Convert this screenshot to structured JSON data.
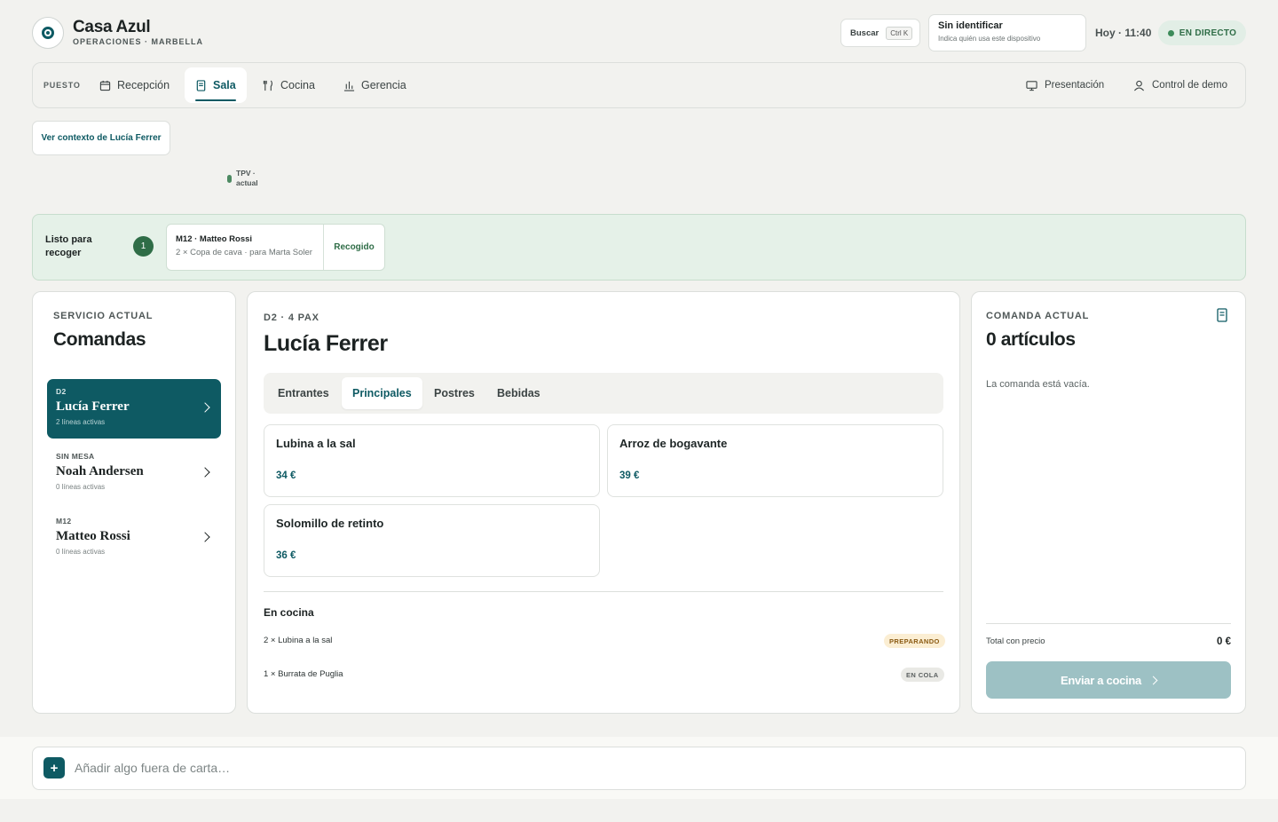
{
  "header": {
    "brand": "Casa Azul",
    "subtitle": "OPERACIONES · MARBELLA",
    "search_label": "Buscar",
    "search_shortcut": "Ctrl K",
    "identity_title": "Sin identificar",
    "identity_hint": "Indica quién usa este dispositivo",
    "time": "Hoy · 11:40",
    "live_label": "EN DIRECTO"
  },
  "nav": {
    "label": "PUESTO",
    "tabs": [
      {
        "label": "Recepción",
        "icon": "calendar-icon"
      },
      {
        "label": "Sala",
        "icon": "receipt-icon",
        "active": true
      },
      {
        "label": "Cocina",
        "icon": "utensils-icon"
      },
      {
        "label": "Gerencia",
        "icon": "bar-chart-icon"
      }
    ],
    "presentation": "Presentación",
    "demo_control": "Control de demo"
  },
  "context": {
    "button": "Ver contexto de Lucía Ferrer",
    "tpv_line1": "TPV ·",
    "tpv_line2": "actual"
  },
  "ready": {
    "title": "Listo para recoger",
    "count": "1",
    "item_title": "M12 · Matteo Rossi",
    "item_detail": "2 × Copa de cava · para Marta Soler",
    "action": "Recogido"
  },
  "orders": {
    "eyebrow": "SERVICIO ACTUAL",
    "title": "Comandas",
    "items": [
      {
        "table": "D2",
        "name": "Lucía Ferrer",
        "lines": "2 líneas activas",
        "selected": true
      },
      {
        "table": "SIN MESA",
        "name": "Noah Andersen",
        "lines": "0 líneas activas"
      },
      {
        "table": "M12",
        "name": "Matteo Rossi",
        "lines": "0 líneas activas"
      }
    ]
  },
  "detail": {
    "eyebrow": "D2 · 4 PAX",
    "title": "Lucía Ferrer",
    "categories": [
      "Entrantes",
      "Principales",
      "Postres",
      "Bebidas"
    ],
    "active_category": "Principales",
    "dishes": [
      {
        "name": "Lubina a la sal",
        "price": "34 €"
      },
      {
        "name": "Arroz de bogavante",
        "price": "39 €"
      },
      {
        "name": "Solomillo de retinto",
        "price": "36 €"
      }
    ],
    "kitchen_title": "En cocina",
    "kitchen_lines": [
      {
        "text": "2 × Lubina a la sal",
        "status": "PREPARANDO",
        "status_bg": "#fbeed3",
        "status_fg": "#8a5a12"
      },
      {
        "text": "1 × Burrata de Puglia",
        "status": "EN COLA",
        "status_bg": "#e9e9e5",
        "status_fg": "#5b6060"
      }
    ]
  },
  "current": {
    "eyebrow": "COMANDA ACTUAL",
    "title": "0 artículos",
    "empty_text": "La comanda está vacía.",
    "total_label": "Total con precio",
    "total_value": "0 €",
    "send_label": "Enviar a cocina"
  },
  "bottom": {
    "plus": "+",
    "placeholder": "Añadir algo fuera de carta…"
  },
  "colors": {
    "accent": "#0e5a63",
    "live": "#2f6d47",
    "ready_bg": "#e5f1e8"
  }
}
